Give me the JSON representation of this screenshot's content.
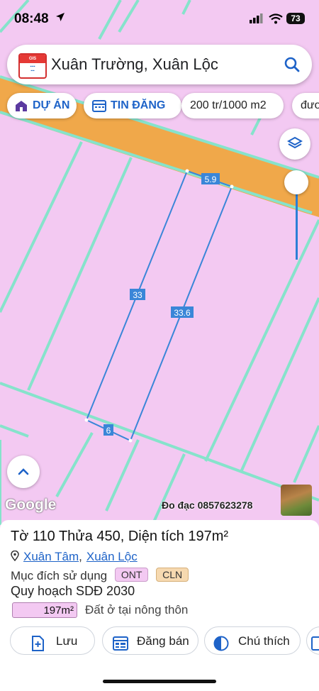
{
  "status": {
    "time": "08:48",
    "battery": "73"
  },
  "search": {
    "query": "Xuân Trường, Xuân Lộc"
  },
  "chips": [
    {
      "label": "DỰ ÁN"
    },
    {
      "label": "TIN ĐĂNG"
    },
    {
      "label": "200 tr/1000 m2"
    },
    {
      "label": "đươ"
    }
  ],
  "map": {
    "edge_labels": {
      "top": "5.9",
      "left": "33",
      "right": "33.6",
      "bottom": "6"
    },
    "google": "Google",
    "attribution": "Đo đạc 0857623278"
  },
  "panel": {
    "title": "Tờ 110 Thửa 450, Diện tích 197m²",
    "location": {
      "commune": "Xuân Tâm",
      "separator": ",",
      "district": "Xuân Lộc"
    },
    "purpose_label": "Mục đích sử dụng",
    "tags": [
      {
        "text": "ONT",
        "color": "#f3c9f2"
      },
      {
        "text": "CLN",
        "color": "#f6d9b0"
      }
    ],
    "plan_label": "Quy hoạch SDĐ 2030",
    "area_value": "197m²",
    "area_desc": "Đất ở tại nông thôn"
  },
  "actions": [
    {
      "label": "Lưu",
      "icon": "add-doc-icon"
    },
    {
      "label": "Đăng bán",
      "icon": "listing-icon"
    },
    {
      "label": "Chú thích",
      "icon": "contrast-icon"
    }
  ],
  "colors": {
    "accent": "#1e63c8",
    "parcel_fill": "#f3c9f2",
    "road": "#f0a84a",
    "boundary": "#7fe0c8"
  }
}
